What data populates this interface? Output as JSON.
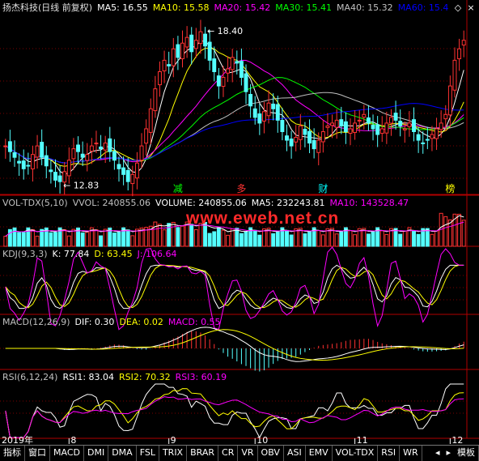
{
  "main": {
    "title": "扬杰科技(日线 前复权)",
    "indicators": [
      {
        "label": "MA5: 16.55",
        "color": "#ffffff"
      },
      {
        "label": "MA10: 15.58",
        "color": "#ffff00"
      },
      {
        "label": "MA20: 15.42",
        "color": "#ff00ff"
      },
      {
        "label": "MA30: 15.41",
        "color": "#00ff00"
      },
      {
        "label": "MA40: 15.32",
        "color": "#c0c0c0"
      },
      {
        "label": "MA60: 15.4",
        "color": "#0000ff"
      }
    ],
    "high_label": "18.40",
    "low_label": "12.83",
    "markers": [
      {
        "text": "减",
        "color": "#00ff00",
        "day": 38
      },
      {
        "text": "多",
        "color": "#ff3333",
        "day": 52
      },
      {
        "text": "财",
        "color": "#00ffff",
        "day": 70
      },
      {
        "text": "榜",
        "color": "#ffff00",
        "day": 98
      }
    ]
  },
  "vol": {
    "name": "VOL-TDX(5,10)",
    "indicators": [
      {
        "label": "VVOL: 240855.06",
        "color": "#c0c0c0"
      },
      {
        "label": "VOLUME: 240855.06",
        "color": "#ffffff"
      },
      {
        "label": "MA5: 232243.81",
        "color": "#ffffff"
      },
      {
        "label": "MA10: 143528.47",
        "color": "#ff00ff"
      }
    ]
  },
  "kdj": {
    "name": "KDJ(9,3,3)",
    "indicators": [
      {
        "label": "K: 77.84",
        "color": "#ffffff"
      },
      {
        "label": "D: 63.45",
        "color": "#ffff00"
      },
      {
        "label": "J: 106.64",
        "color": "#ff00ff"
      }
    ]
  },
  "macd": {
    "name": "MACD(12,26,9)",
    "indicators": [
      {
        "label": "DIF: 0.30",
        "color": "#ffffff"
      },
      {
        "label": "DEA: 0.02",
        "color": "#ffff00"
      },
      {
        "label": "MACD: 0.55",
        "color": "#ff00ff"
      }
    ]
  },
  "rsi": {
    "name": "RSI(6,12,24)",
    "indicators": [
      {
        "label": "RSI1: 83.04",
        "color": "#ffffff"
      },
      {
        "label": "RSI2: 70.32",
        "color": "#ffff00"
      },
      {
        "label": "RSI3: 60.19",
        "color": "#ff00ff"
      }
    ]
  },
  "axis": {
    "year_label": "2019年",
    "months": [
      {
        "label": "8",
        "day": 14
      },
      {
        "label": "9",
        "day": 36
      },
      {
        "label": "10",
        "day": 55
      },
      {
        "label": "11",
        "day": 77
      },
      {
        "label": "12",
        "day": 98
      }
    ]
  },
  "watermark": "www.eweb.net.cn",
  "tabs": [
    "指标",
    "窗口",
    "MACD",
    "DMI",
    "DMA",
    "FSL",
    "TRIX",
    "BRAR",
    "CR",
    "VR",
    "OBV",
    "ASI",
    "EMV",
    "VOL-TDX",
    "RSI",
    "WR"
  ],
  "tab_right": "模板",
  "colors": {
    "up": "#ff3232",
    "down": "#54ffff",
    "frame": "#b00000"
  },
  "chart_data": {
    "type": "candlestick",
    "close": [
      14.2,
      14.0,
      13.8,
      13.6,
      13.4,
      13.5,
      13.9,
      14.2,
      13.8,
      13.5,
      13.3,
      13.0,
      12.95,
      13.3,
      13.7,
      14.1,
      14.0,
      13.8,
      13.9,
      14.2,
      14.3,
      14.1,
      14.3,
      14.0,
      13.7,
      13.4,
      13.2,
      12.95,
      13.2,
      13.6,
      14.2,
      14.8,
      15.5,
      16.2,
      16.8,
      17.2,
      17.0,
      17.6,
      17.3,
      17.8,
      18.0,
      17.5,
      17.9,
      18.2,
      17.7,
      17.2,
      16.8,
      16.3,
      16.6,
      16.9,
      17.3,
      17.1,
      16.6,
      16.1,
      15.6,
      15.2,
      15.0,
      15.4,
      15.7,
      15.5,
      15.1,
      14.7,
      14.4,
      14.2,
      14.5,
      14.9,
      14.6,
      14.3,
      14.1,
      14.4,
      14.7,
      14.9,
      15.0,
      15.1,
      14.9,
      14.7,
      14.8,
      15.0,
      15.1,
      15.3,
      15.0,
      14.8,
      14.6,
      14.8,
      15.0,
      15.2,
      15.1,
      14.9,
      14.8,
      15.0,
      14.7,
      14.4,
      14.3,
      14.4,
      14.6,
      14.8,
      15.0,
      15.3,
      16.3,
      17.2,
      17.6,
      17.9
    ],
    "high_price": 18.4,
    "low_price": 12.83,
    "volume_last": 240855.06,
    "kdj_last": {
      "K": 77.84,
      "D": 63.45,
      "J": 106.64
    },
    "macd_last": {
      "DIF": 0.3,
      "DEA": 0.02,
      "MACD": 0.55
    },
    "rsi_last": {
      "RSI1": 83.04,
      "RSI2": 70.32,
      "RSI3": 60.19
    }
  }
}
